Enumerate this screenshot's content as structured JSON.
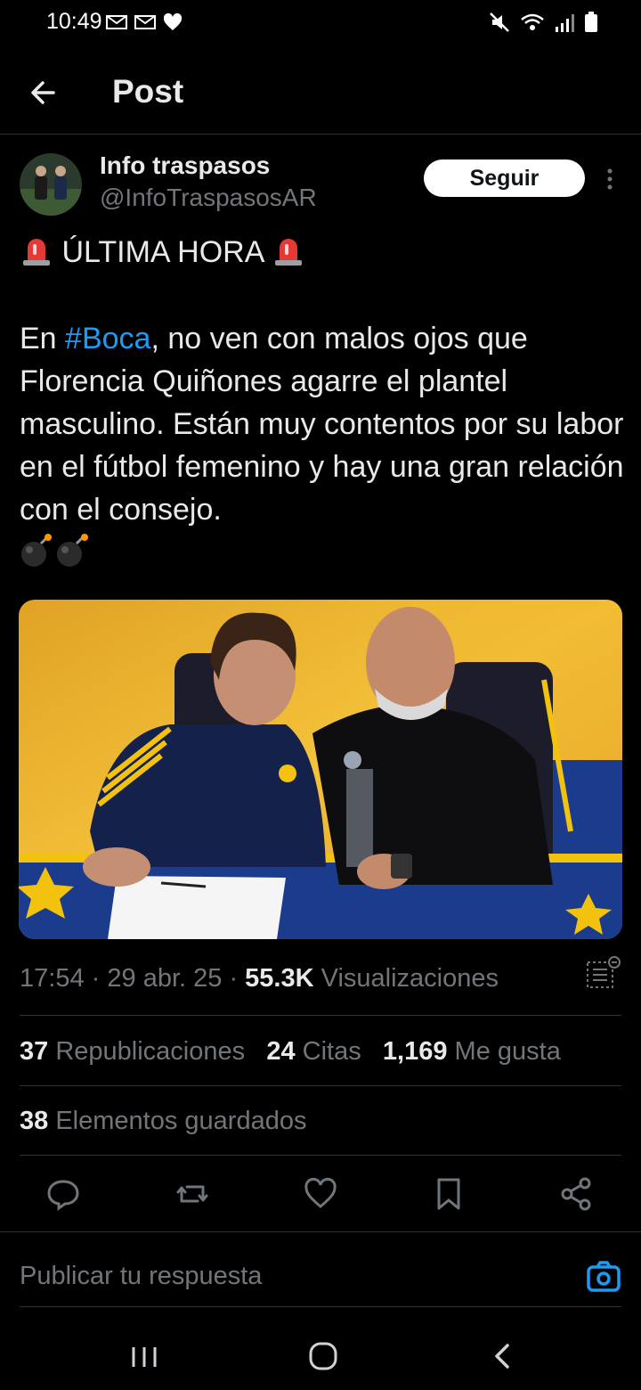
{
  "status_bar": {
    "time": "10:49",
    "icons": [
      "email-icon",
      "email-icon",
      "heart-icon",
      "mute-icon",
      "wifi-icon",
      "signal-icon",
      "battery-icon"
    ]
  },
  "header": {
    "title": "Post",
    "back_icon": "arrow-left-icon"
  },
  "post": {
    "author_name": "Info traspasos",
    "author_handle": "@InfoTraspasosAR",
    "follow_label": "Seguir",
    "headline": "ÚLTIMA HORA",
    "body_prefix": "En ",
    "hashtag": "#Boca",
    "body_suffix": ", no ven con malos ojos que Florencia Quiñones agarre el plantel masculino. Están muy contentos por su labor en el fútbol femenino y hay una gran relación con el consejo.",
    "emoji_line": "💣💣",
    "time": "17:54",
    "date": "29 abr. 25",
    "sep": "·",
    "views": "55.3K",
    "views_label": "Visualizaciones",
    "reposts": "37",
    "reposts_label": "Republicaciones",
    "quotes": "24",
    "quotes_label": "Citas",
    "likes": "1,169",
    "likes_label": "Me gusta",
    "bookmarks": "38",
    "bookmarks_label": "Elementos guardados"
  },
  "reply": {
    "placeholder": "Publicar tu respuesta"
  },
  "colors": {
    "background": "#000000",
    "text": "#e7e9ea",
    "muted": "#71767b",
    "accent": "#1d9bf0",
    "divider": "#2f3336"
  }
}
